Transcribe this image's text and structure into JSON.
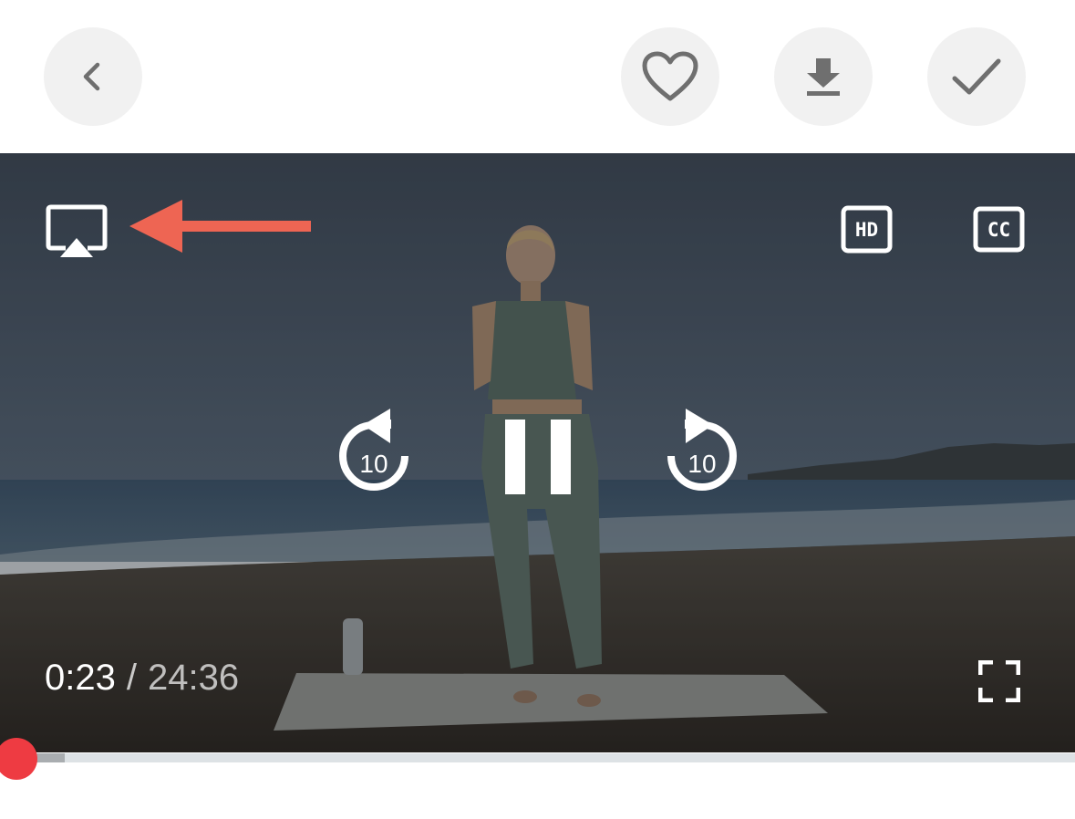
{
  "header": {
    "back_icon": "chevron-left-icon",
    "favorite_icon": "heart-outline-icon",
    "download_icon": "download-icon",
    "complete_icon": "checkmark-icon"
  },
  "player": {
    "airplay_icon": "airplay-icon",
    "hd_label": "HD",
    "cc_label": "CC",
    "rewind_seconds": "10",
    "forward_seconds": "10",
    "pause_icon": "pause-icon",
    "fullscreen_icon": "fullscreen-icon",
    "current_time": "0:23",
    "time_separator": "/",
    "duration": "24:36",
    "progress_fraction": 0.0156,
    "buffered_fraction": 0.06,
    "progress_color": "#ee3b42"
  },
  "annotation": {
    "arrow_color": "#ee6553",
    "points_to": "airplay-button"
  }
}
